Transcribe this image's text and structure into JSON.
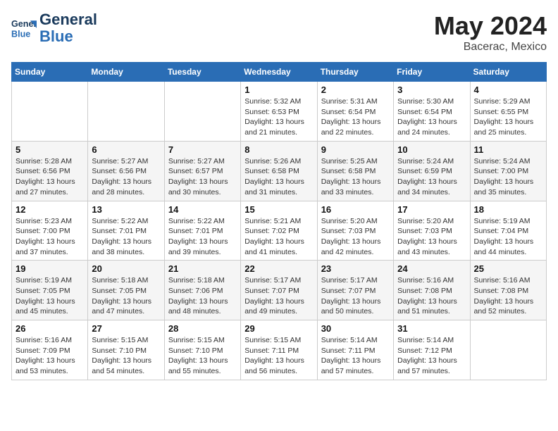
{
  "header": {
    "logo_line1": "General",
    "logo_line2": "Blue",
    "month": "May 2024",
    "location": "Bacerac, Mexico"
  },
  "weekdays": [
    "Sunday",
    "Monday",
    "Tuesday",
    "Wednesday",
    "Thursday",
    "Friday",
    "Saturday"
  ],
  "weeks": [
    [
      {
        "day": "",
        "sunrise": "",
        "sunset": "",
        "daylight": ""
      },
      {
        "day": "",
        "sunrise": "",
        "sunset": "",
        "daylight": ""
      },
      {
        "day": "",
        "sunrise": "",
        "sunset": "",
        "daylight": ""
      },
      {
        "day": "1",
        "sunrise": "Sunrise: 5:32 AM",
        "sunset": "Sunset: 6:53 PM",
        "daylight": "Daylight: 13 hours and 21 minutes."
      },
      {
        "day": "2",
        "sunrise": "Sunrise: 5:31 AM",
        "sunset": "Sunset: 6:54 PM",
        "daylight": "Daylight: 13 hours and 22 minutes."
      },
      {
        "day": "3",
        "sunrise": "Sunrise: 5:30 AM",
        "sunset": "Sunset: 6:54 PM",
        "daylight": "Daylight: 13 hours and 24 minutes."
      },
      {
        "day": "4",
        "sunrise": "Sunrise: 5:29 AM",
        "sunset": "Sunset: 6:55 PM",
        "daylight": "Daylight: 13 hours and 25 minutes."
      }
    ],
    [
      {
        "day": "5",
        "sunrise": "Sunrise: 5:28 AM",
        "sunset": "Sunset: 6:56 PM",
        "daylight": "Daylight: 13 hours and 27 minutes."
      },
      {
        "day": "6",
        "sunrise": "Sunrise: 5:27 AM",
        "sunset": "Sunset: 6:56 PM",
        "daylight": "Daylight: 13 hours and 28 minutes."
      },
      {
        "day": "7",
        "sunrise": "Sunrise: 5:27 AM",
        "sunset": "Sunset: 6:57 PM",
        "daylight": "Daylight: 13 hours and 30 minutes."
      },
      {
        "day": "8",
        "sunrise": "Sunrise: 5:26 AM",
        "sunset": "Sunset: 6:58 PM",
        "daylight": "Daylight: 13 hours and 31 minutes."
      },
      {
        "day": "9",
        "sunrise": "Sunrise: 5:25 AM",
        "sunset": "Sunset: 6:58 PM",
        "daylight": "Daylight: 13 hours and 33 minutes."
      },
      {
        "day": "10",
        "sunrise": "Sunrise: 5:24 AM",
        "sunset": "Sunset: 6:59 PM",
        "daylight": "Daylight: 13 hours and 34 minutes."
      },
      {
        "day": "11",
        "sunrise": "Sunrise: 5:24 AM",
        "sunset": "Sunset: 7:00 PM",
        "daylight": "Daylight: 13 hours and 35 minutes."
      }
    ],
    [
      {
        "day": "12",
        "sunrise": "Sunrise: 5:23 AM",
        "sunset": "Sunset: 7:00 PM",
        "daylight": "Daylight: 13 hours and 37 minutes."
      },
      {
        "day": "13",
        "sunrise": "Sunrise: 5:22 AM",
        "sunset": "Sunset: 7:01 PM",
        "daylight": "Daylight: 13 hours and 38 minutes."
      },
      {
        "day": "14",
        "sunrise": "Sunrise: 5:22 AM",
        "sunset": "Sunset: 7:01 PM",
        "daylight": "Daylight: 13 hours and 39 minutes."
      },
      {
        "day": "15",
        "sunrise": "Sunrise: 5:21 AM",
        "sunset": "Sunset: 7:02 PM",
        "daylight": "Daylight: 13 hours and 41 minutes."
      },
      {
        "day": "16",
        "sunrise": "Sunrise: 5:20 AM",
        "sunset": "Sunset: 7:03 PM",
        "daylight": "Daylight: 13 hours and 42 minutes."
      },
      {
        "day": "17",
        "sunrise": "Sunrise: 5:20 AM",
        "sunset": "Sunset: 7:03 PM",
        "daylight": "Daylight: 13 hours and 43 minutes."
      },
      {
        "day": "18",
        "sunrise": "Sunrise: 5:19 AM",
        "sunset": "Sunset: 7:04 PM",
        "daylight": "Daylight: 13 hours and 44 minutes."
      }
    ],
    [
      {
        "day": "19",
        "sunrise": "Sunrise: 5:19 AM",
        "sunset": "Sunset: 7:05 PM",
        "daylight": "Daylight: 13 hours and 45 minutes."
      },
      {
        "day": "20",
        "sunrise": "Sunrise: 5:18 AM",
        "sunset": "Sunset: 7:05 PM",
        "daylight": "Daylight: 13 hours and 47 minutes."
      },
      {
        "day": "21",
        "sunrise": "Sunrise: 5:18 AM",
        "sunset": "Sunset: 7:06 PM",
        "daylight": "Daylight: 13 hours and 48 minutes."
      },
      {
        "day": "22",
        "sunrise": "Sunrise: 5:17 AM",
        "sunset": "Sunset: 7:07 PM",
        "daylight": "Daylight: 13 hours and 49 minutes."
      },
      {
        "day": "23",
        "sunrise": "Sunrise: 5:17 AM",
        "sunset": "Sunset: 7:07 PM",
        "daylight": "Daylight: 13 hours and 50 minutes."
      },
      {
        "day": "24",
        "sunrise": "Sunrise: 5:16 AM",
        "sunset": "Sunset: 7:08 PM",
        "daylight": "Daylight: 13 hours and 51 minutes."
      },
      {
        "day": "25",
        "sunrise": "Sunrise: 5:16 AM",
        "sunset": "Sunset: 7:08 PM",
        "daylight": "Daylight: 13 hours and 52 minutes."
      }
    ],
    [
      {
        "day": "26",
        "sunrise": "Sunrise: 5:16 AM",
        "sunset": "Sunset: 7:09 PM",
        "daylight": "Daylight: 13 hours and 53 minutes."
      },
      {
        "day": "27",
        "sunrise": "Sunrise: 5:15 AM",
        "sunset": "Sunset: 7:10 PM",
        "daylight": "Daylight: 13 hours and 54 minutes."
      },
      {
        "day": "28",
        "sunrise": "Sunrise: 5:15 AM",
        "sunset": "Sunset: 7:10 PM",
        "daylight": "Daylight: 13 hours and 55 minutes."
      },
      {
        "day": "29",
        "sunrise": "Sunrise: 5:15 AM",
        "sunset": "Sunset: 7:11 PM",
        "daylight": "Daylight: 13 hours and 56 minutes."
      },
      {
        "day": "30",
        "sunrise": "Sunrise: 5:14 AM",
        "sunset": "Sunset: 7:11 PM",
        "daylight": "Daylight: 13 hours and 57 minutes."
      },
      {
        "day": "31",
        "sunrise": "Sunrise: 5:14 AM",
        "sunset": "Sunset: 7:12 PM",
        "daylight": "Daylight: 13 hours and 57 minutes."
      },
      {
        "day": "",
        "sunrise": "",
        "sunset": "",
        "daylight": ""
      }
    ]
  ]
}
